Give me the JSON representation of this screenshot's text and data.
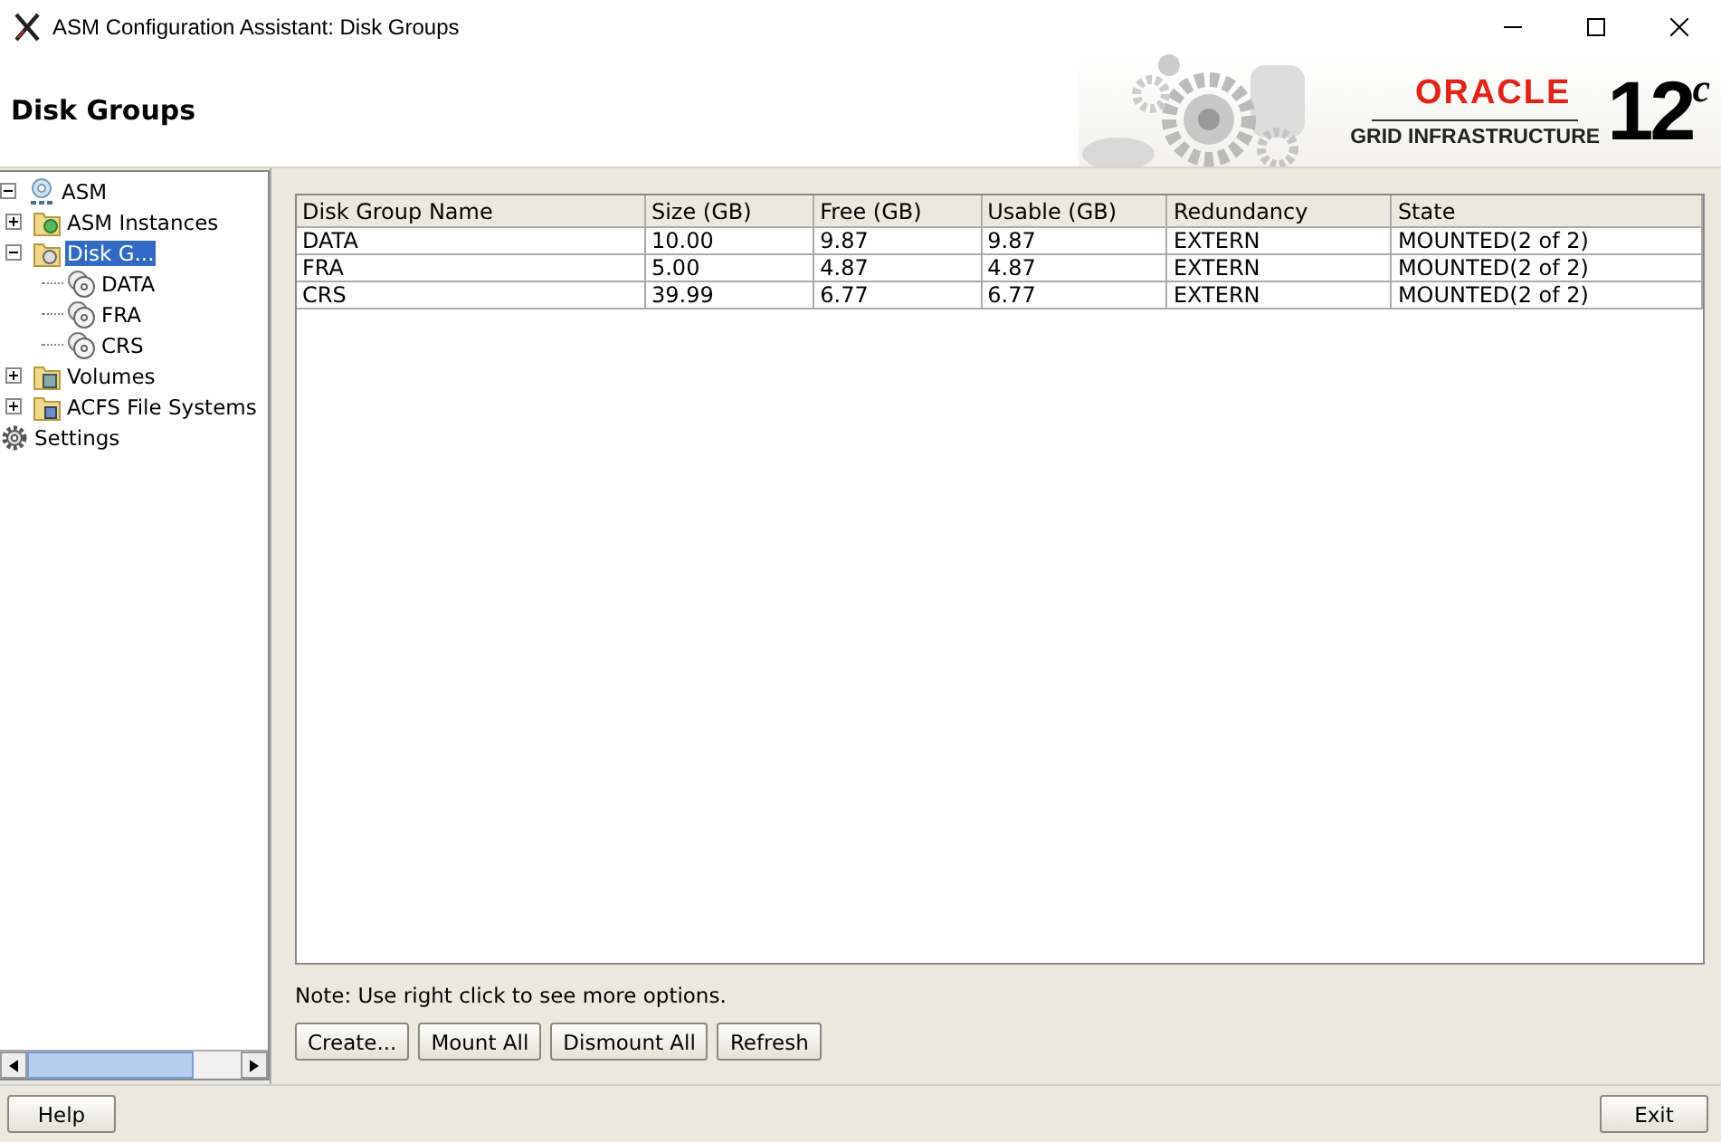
{
  "window": {
    "title": "ASM Configuration Assistant: Disk Groups"
  },
  "header": {
    "title": "Disk Groups",
    "logo": {
      "brand": "ORACLE",
      "product": "GRID INFRASTRUCTURE",
      "version": "12",
      "version_suffix": "c"
    }
  },
  "tree": [
    {
      "label": "ASM",
      "kind": "asm",
      "selected": false,
      "expanded": true,
      "children": [
        {
          "label": "ASM Instances",
          "kind": "instances",
          "selected": false,
          "expanded": false
        },
        {
          "label": "Disk G...",
          "kind": "diskgroups",
          "selected": true,
          "expanded": true,
          "children": [
            {
              "label": "DATA",
              "kind": "disk",
              "selected": false
            },
            {
              "label": "FRA",
              "kind": "disk",
              "selected": false
            },
            {
              "label": "CRS",
              "kind": "disk",
              "selected": false
            }
          ]
        },
        {
          "label": "Volumes",
          "kind": "volumes",
          "selected": false,
          "expanded": false
        },
        {
          "label": "ACFS File Systems",
          "kind": "acfs",
          "selected": false,
          "expanded": false
        }
      ]
    },
    {
      "label": "Settings",
      "kind": "settings",
      "selected": false
    }
  ],
  "table": {
    "columns": [
      "Disk Group Name",
      "Size (GB)",
      "Free (GB)",
      "Usable (GB)",
      "Redundancy",
      "State"
    ],
    "rows": [
      [
        "DATA",
        "10.00",
        "9.87",
        "9.87",
        "EXTERN",
        "MOUNTED(2 of 2)"
      ],
      [
        "FRA",
        "5.00",
        "4.87",
        "4.87",
        "EXTERN",
        "MOUNTED(2 of 2)"
      ],
      [
        "CRS",
        "39.99",
        "6.77",
        "6.77",
        "EXTERN",
        "MOUNTED(2 of 2)"
      ]
    ]
  },
  "note": "Note: Use right click to see more options.",
  "actions": [
    "Create...",
    "Mount All",
    "Dismount All",
    "Refresh"
  ],
  "footer": {
    "help": "Help",
    "exit": "Exit"
  }
}
